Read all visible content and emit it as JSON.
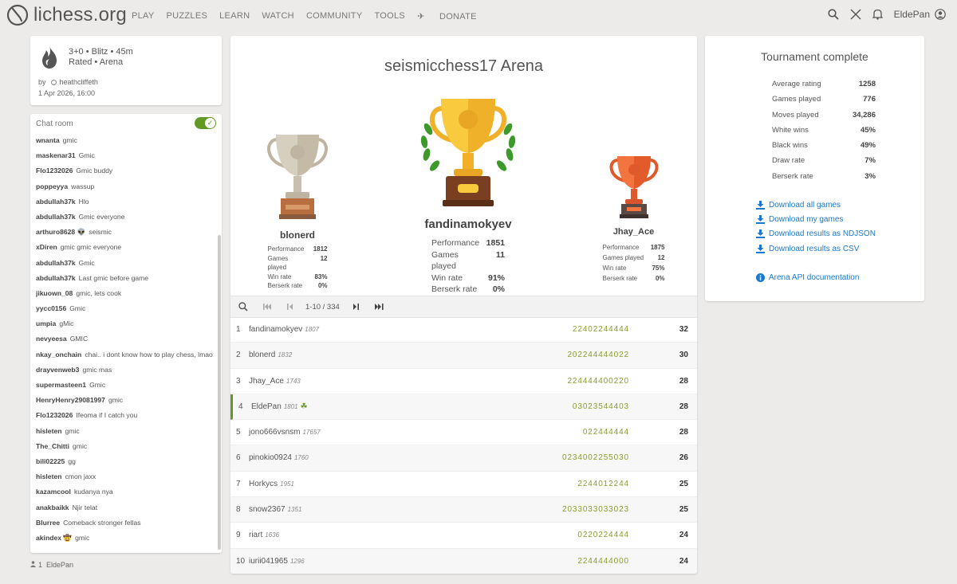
{
  "header": {
    "logo": "lichess.org",
    "nav": [
      "PLAY",
      "PUZZLES",
      "LEARN",
      "WATCH",
      "COMMUNITY",
      "TOOLS"
    ],
    "donate": "DONATE",
    "username": "EldePan"
  },
  "tournament_info": {
    "line1": "3+0 • Blitz • 45m",
    "line2": "Rated • Arena",
    "by_label": "by",
    "creator": "heathcliffeth",
    "date": "1 Apr 2026, 16:00"
  },
  "chat": {
    "title": "Chat room",
    "messages": [
      {
        "user": "wnanta",
        "text": "gmic"
      },
      {
        "user": "maskenar31",
        "text": "Gmic"
      },
      {
        "user": "Flo1232026",
        "text": "Gmic buddy"
      },
      {
        "user": "poppeyya",
        "text": "wassup"
      },
      {
        "user": "abdullah37k",
        "text": "Hlo"
      },
      {
        "user": "abdullah37k",
        "text": "Gmic everyone"
      },
      {
        "user": "arthuro8628 👽",
        "text": "seismic"
      },
      {
        "user": "xDiren",
        "text": "gmic gmic everyone"
      },
      {
        "user": "abdullah37k",
        "text": "Gmic"
      },
      {
        "user": "abdullah37k",
        "text": "Last gmic before game"
      },
      {
        "user": "jikuown_08",
        "text": "gmic, lets cook"
      },
      {
        "user": "yycc0156",
        "text": "Gmic"
      },
      {
        "user": "umpia",
        "text": "gMic"
      },
      {
        "user": "nevyeesa",
        "text": "GMIC"
      },
      {
        "user": "nkay_onchain",
        "text": "chai.. i dont know how to play chess, lmao"
      },
      {
        "user": "drayvenweb3",
        "text": "gmic mas"
      },
      {
        "user": "supermasteen1",
        "text": "Gmic"
      },
      {
        "user": "HenryHenry29081997",
        "text": "gmic"
      },
      {
        "user": "Flo1232026",
        "text": "Ifeoma if I catch you"
      },
      {
        "user": "hisleten",
        "text": "gmic"
      },
      {
        "user": "The_Chitti",
        "text": "gmic"
      },
      {
        "user": "bili02225",
        "text": "gg"
      },
      {
        "user": "hisleten",
        "text": "cmon jaxx"
      },
      {
        "user": "kazamcool",
        "text": "kudanya nya"
      },
      {
        "user": "anakbaikk",
        "text": "Njir telat"
      },
      {
        "user": "Blurree",
        "text": "Comeback stronger fellas"
      },
      {
        "user": "akindex 🤠",
        "text": "gmic"
      }
    ],
    "members_count": "1",
    "members_name": "EldePan"
  },
  "main": {
    "title": "seismicchess17 Arena",
    "podium": {
      "first": {
        "name": "fandinamokyev",
        "performance": "1851",
        "games": "11",
        "winrate": "91%",
        "berserk": "0%"
      },
      "second": {
        "name": "blonerd",
        "performance": "1812",
        "games": "12",
        "winrate": "83%",
        "berserk": "0%"
      },
      "third": {
        "name": "Jhay_Ace",
        "performance": "1875",
        "games": "12",
        "winrate": "75%",
        "berserk": "0%"
      }
    },
    "stat_labels": {
      "performance": "Performance",
      "games": "Games played",
      "winrate": "Win rate",
      "berserk": "Berserk rate"
    },
    "pager": "1-10 / 334",
    "standings": [
      {
        "rank": "1",
        "name": "fandinamokyev",
        "rating": "1807",
        "sheet": "22402244444",
        "score": "32"
      },
      {
        "rank": "2",
        "name": "blonerd",
        "rating": "1832",
        "sheet": "202244444022",
        "score": "30"
      },
      {
        "rank": "3",
        "name": "Jhay_Ace",
        "rating": "1743",
        "sheet": "224444400220",
        "score": "28"
      },
      {
        "rank": "4",
        "name": "EldePan",
        "rating": "1801",
        "sheet": "03023544403",
        "score": "28"
      },
      {
        "rank": "5",
        "name": "jono666vsnsm",
        "rating": "17657",
        "sheet": "022444444",
        "score": "28"
      },
      {
        "rank": "6",
        "name": "pinokio0924",
        "rating": "1760",
        "sheet": "0234002255030",
        "score": "26"
      },
      {
        "rank": "7",
        "name": "Horkycs",
        "rating": "1951",
        "sheet": "2244012244",
        "score": "25"
      },
      {
        "rank": "8",
        "name": "snow2367",
        "rating": "1351",
        "sheet": "2033033033023",
        "score": "25"
      },
      {
        "rank": "9",
        "name": "riart",
        "rating": "1636",
        "sheet": "0220224444",
        "score": "24"
      },
      {
        "rank": "10",
        "name": "iurii041965",
        "rating": "1296",
        "sheet": "2244444000",
        "score": "24"
      }
    ]
  },
  "side": {
    "title": "Tournament complete",
    "stats": [
      {
        "label": "Average rating",
        "value": "1258"
      },
      {
        "label": "Games played",
        "value": "776"
      },
      {
        "label": "Moves played",
        "value": "34,286"
      },
      {
        "label": "White wins",
        "value": "45%"
      },
      {
        "label": "Black wins",
        "value": "49%"
      },
      {
        "label": "Draw rate",
        "value": "7%"
      },
      {
        "label": "Berserk rate",
        "value": "3%"
      }
    ],
    "downloads": [
      "Download all games",
      "Download my games",
      "Download results as NDJSON",
      "Download results as CSV"
    ],
    "api_link": "Arena API documentation"
  },
  "colors": {
    "accent_green": "#629924",
    "link_blue": "#1b78d0",
    "donate_orange": "#d59120",
    "gold": "#f5b82e",
    "silver": "#c9bfae",
    "bronze": "#f26b3a"
  }
}
